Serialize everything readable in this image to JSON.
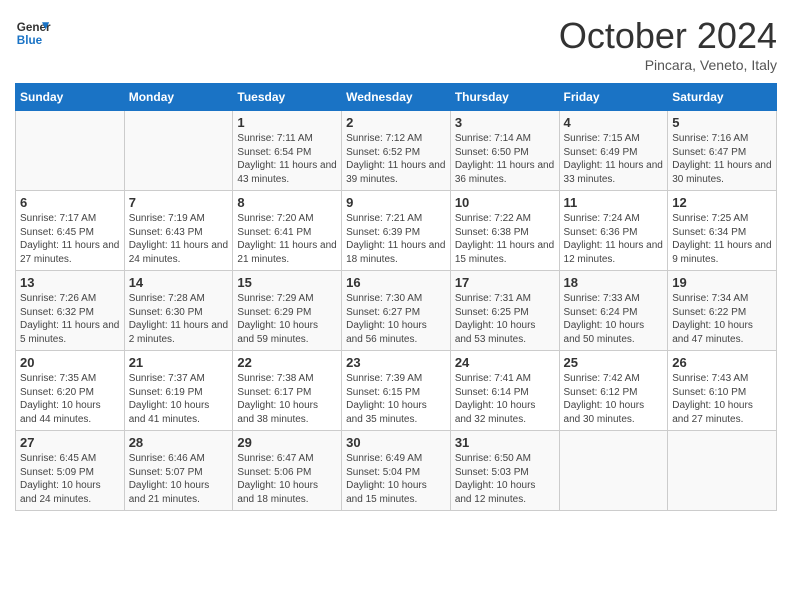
{
  "logo": {
    "line1": "General",
    "line2": "Blue"
  },
  "title": "October 2024",
  "subtitle": "Pincara, Veneto, Italy",
  "days_of_week": [
    "Sunday",
    "Monday",
    "Tuesday",
    "Wednesday",
    "Thursday",
    "Friday",
    "Saturday"
  ],
  "weeks": [
    [
      {
        "day": null,
        "content": null
      },
      {
        "day": null,
        "content": null
      },
      {
        "day": "1",
        "content": "Sunrise: 7:11 AM\nSunset: 6:54 PM\nDaylight: 11 hours and 43 minutes."
      },
      {
        "day": "2",
        "content": "Sunrise: 7:12 AM\nSunset: 6:52 PM\nDaylight: 11 hours and 39 minutes."
      },
      {
        "day": "3",
        "content": "Sunrise: 7:14 AM\nSunset: 6:50 PM\nDaylight: 11 hours and 36 minutes."
      },
      {
        "day": "4",
        "content": "Sunrise: 7:15 AM\nSunset: 6:49 PM\nDaylight: 11 hours and 33 minutes."
      },
      {
        "day": "5",
        "content": "Sunrise: 7:16 AM\nSunset: 6:47 PM\nDaylight: 11 hours and 30 minutes."
      }
    ],
    [
      {
        "day": "6",
        "content": "Sunrise: 7:17 AM\nSunset: 6:45 PM\nDaylight: 11 hours and 27 minutes."
      },
      {
        "day": "7",
        "content": "Sunrise: 7:19 AM\nSunset: 6:43 PM\nDaylight: 11 hours and 24 minutes."
      },
      {
        "day": "8",
        "content": "Sunrise: 7:20 AM\nSunset: 6:41 PM\nDaylight: 11 hours and 21 minutes."
      },
      {
        "day": "9",
        "content": "Sunrise: 7:21 AM\nSunset: 6:39 PM\nDaylight: 11 hours and 18 minutes."
      },
      {
        "day": "10",
        "content": "Sunrise: 7:22 AM\nSunset: 6:38 PM\nDaylight: 11 hours and 15 minutes."
      },
      {
        "day": "11",
        "content": "Sunrise: 7:24 AM\nSunset: 6:36 PM\nDaylight: 11 hours and 12 minutes."
      },
      {
        "day": "12",
        "content": "Sunrise: 7:25 AM\nSunset: 6:34 PM\nDaylight: 11 hours and 9 minutes."
      }
    ],
    [
      {
        "day": "13",
        "content": "Sunrise: 7:26 AM\nSunset: 6:32 PM\nDaylight: 11 hours and 5 minutes."
      },
      {
        "day": "14",
        "content": "Sunrise: 7:28 AM\nSunset: 6:30 PM\nDaylight: 11 hours and 2 minutes."
      },
      {
        "day": "15",
        "content": "Sunrise: 7:29 AM\nSunset: 6:29 PM\nDaylight: 10 hours and 59 minutes."
      },
      {
        "day": "16",
        "content": "Sunrise: 7:30 AM\nSunset: 6:27 PM\nDaylight: 10 hours and 56 minutes."
      },
      {
        "day": "17",
        "content": "Sunrise: 7:31 AM\nSunset: 6:25 PM\nDaylight: 10 hours and 53 minutes."
      },
      {
        "day": "18",
        "content": "Sunrise: 7:33 AM\nSunset: 6:24 PM\nDaylight: 10 hours and 50 minutes."
      },
      {
        "day": "19",
        "content": "Sunrise: 7:34 AM\nSunset: 6:22 PM\nDaylight: 10 hours and 47 minutes."
      }
    ],
    [
      {
        "day": "20",
        "content": "Sunrise: 7:35 AM\nSunset: 6:20 PM\nDaylight: 10 hours and 44 minutes."
      },
      {
        "day": "21",
        "content": "Sunrise: 7:37 AM\nSunset: 6:19 PM\nDaylight: 10 hours and 41 minutes."
      },
      {
        "day": "22",
        "content": "Sunrise: 7:38 AM\nSunset: 6:17 PM\nDaylight: 10 hours and 38 minutes."
      },
      {
        "day": "23",
        "content": "Sunrise: 7:39 AM\nSunset: 6:15 PM\nDaylight: 10 hours and 35 minutes."
      },
      {
        "day": "24",
        "content": "Sunrise: 7:41 AM\nSunset: 6:14 PM\nDaylight: 10 hours and 32 minutes."
      },
      {
        "day": "25",
        "content": "Sunrise: 7:42 AM\nSunset: 6:12 PM\nDaylight: 10 hours and 30 minutes."
      },
      {
        "day": "26",
        "content": "Sunrise: 7:43 AM\nSunset: 6:10 PM\nDaylight: 10 hours and 27 minutes."
      }
    ],
    [
      {
        "day": "27",
        "content": "Sunrise: 6:45 AM\nSunset: 5:09 PM\nDaylight: 10 hours and 24 minutes."
      },
      {
        "day": "28",
        "content": "Sunrise: 6:46 AM\nSunset: 5:07 PM\nDaylight: 10 hours and 21 minutes."
      },
      {
        "day": "29",
        "content": "Sunrise: 6:47 AM\nSunset: 5:06 PM\nDaylight: 10 hours and 18 minutes."
      },
      {
        "day": "30",
        "content": "Sunrise: 6:49 AM\nSunset: 5:04 PM\nDaylight: 10 hours and 15 minutes."
      },
      {
        "day": "31",
        "content": "Sunrise: 6:50 AM\nSunset: 5:03 PM\nDaylight: 10 hours and 12 minutes."
      },
      {
        "day": null,
        "content": null
      },
      {
        "day": null,
        "content": null
      }
    ]
  ]
}
